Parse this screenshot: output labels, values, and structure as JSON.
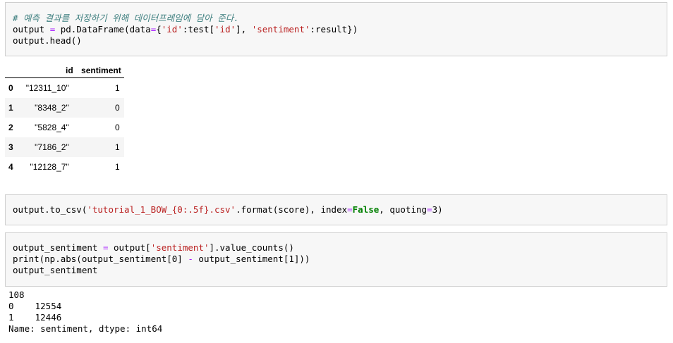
{
  "cell1": {
    "comment": "# 예측 결과를 저장하기 위해 데이터프레임에 담아 준다.",
    "line2_a": "output ",
    "line2_eq": "=",
    "line2_b": " pd.DataFrame(data",
    "line2_eq2": "=",
    "line2_c": "{",
    "line2_s1": "'id'",
    "line2_d": ":test[",
    "line2_s2": "'id'",
    "line2_e": "], ",
    "line2_s3": "'sentiment'",
    "line2_f": ":result})",
    "line3": "output.head()"
  },
  "dataframe": {
    "columns": [
      "id",
      "sentiment"
    ],
    "rows": [
      {
        "index": "0",
        "id": "\"12311_10\"",
        "sentiment": "1"
      },
      {
        "index": "1",
        "id": "\"8348_2\"",
        "sentiment": "0"
      },
      {
        "index": "2",
        "id": "\"5828_4\"",
        "sentiment": "0"
      },
      {
        "index": "3",
        "id": "\"7186_2\"",
        "sentiment": "1"
      },
      {
        "index": "4",
        "id": "\"12128_7\"",
        "sentiment": "1"
      }
    ]
  },
  "cell2": {
    "a": "output.to_csv(",
    "s1": "'tutorial_1_BOW_{0:.5f}.csv'",
    "b": ".format(score), index",
    "eq1": "=",
    "kw": "False",
    "c": ", quoting",
    "eq2": "=",
    "d": "3)"
  },
  "cell3": {
    "l1_a": "output_sentiment ",
    "l1_eq": "=",
    "l1_b": " output[",
    "l1_s": "'sentiment'",
    "l1_c": "].value_counts()",
    "l2_a": "print(np.abs(output_sentiment[0] ",
    "l2_op": "-",
    "l2_b": " output_sentiment[1]))",
    "l3": "output_sentiment"
  },
  "output3": {
    "lines": [
      "108",
      "0    12554",
      "1    12446",
      "Name: sentiment, dtype: int64"
    ]
  }
}
